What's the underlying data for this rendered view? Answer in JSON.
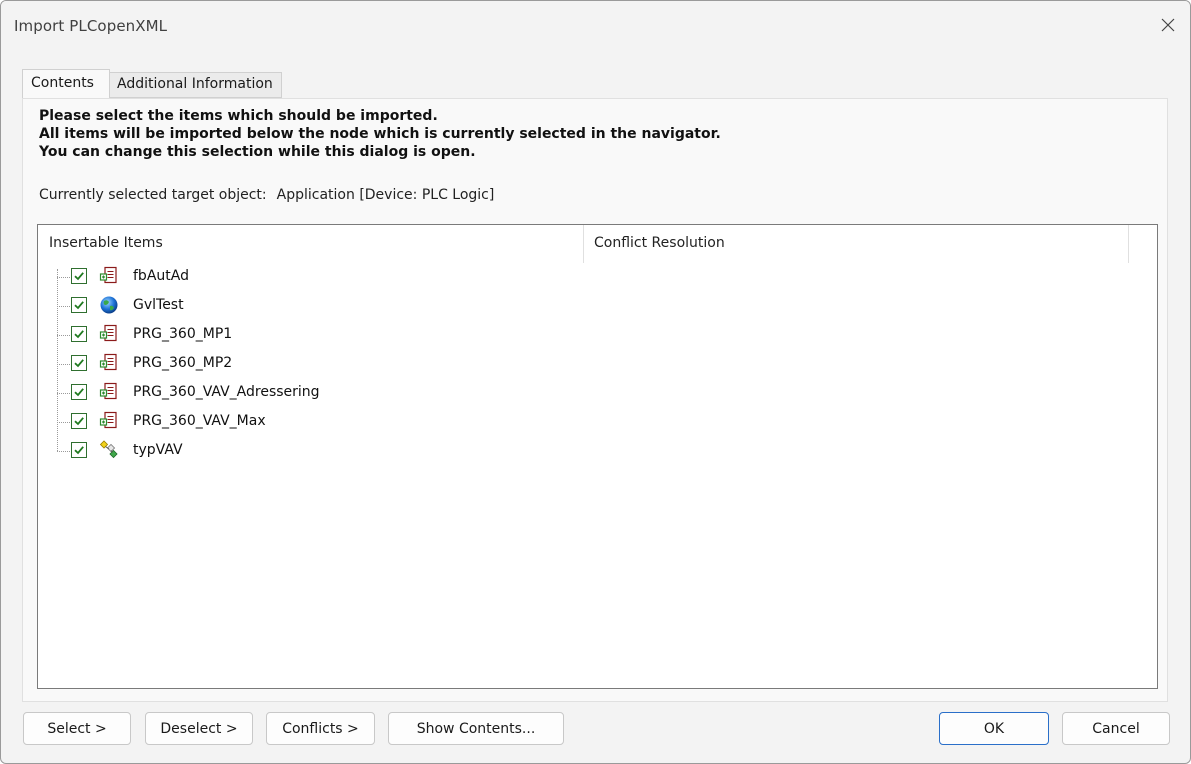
{
  "window": {
    "title": "Import PLCopenXML",
    "close_icon": "close-icon"
  },
  "tabs": [
    {
      "label": "Contents",
      "active": true
    },
    {
      "label": "Additional Information",
      "active": false
    }
  ],
  "instructions": {
    "line1": "Please select the items which should be imported.",
    "line2": "All items will be imported below the node which is currently selected in the navigator.",
    "line3": "You can change this selection while this dialog is open."
  },
  "target": {
    "label": "Currently selected target object:",
    "value": "Application [Device: PLC Logic]"
  },
  "columns": {
    "insertable": "Insertable Items",
    "conflict": "Conflict Resolution"
  },
  "items": [
    {
      "label": "fbAutAd",
      "checked": true,
      "icon": "pou-icon"
    },
    {
      "label": "GvlTest",
      "checked": true,
      "icon": "globe-icon"
    },
    {
      "label": "PRG_360_MP1",
      "checked": true,
      "icon": "pou-icon"
    },
    {
      "label": "PRG_360_MP2",
      "checked": true,
      "icon": "pou-icon"
    },
    {
      "label": "PRG_360_VAV_Adressering",
      "checked": true,
      "icon": "pou-icon"
    },
    {
      "label": "PRG_360_VAV_Max",
      "checked": true,
      "icon": "pou-icon"
    },
    {
      "label": "typVAV",
      "checked": true,
      "icon": "dut-icon"
    }
  ],
  "buttons": {
    "select": "Select >",
    "deselect": "Deselect >",
    "conflicts": "Conflicts >",
    "show_contents": "Show Contents...",
    "ok": "OK",
    "cancel": "Cancel"
  },
  "colors": {
    "checkbox_border": "#2f6f2f",
    "checkmark": "#1f7a1f",
    "ok_border": "#2a6fc9"
  }
}
